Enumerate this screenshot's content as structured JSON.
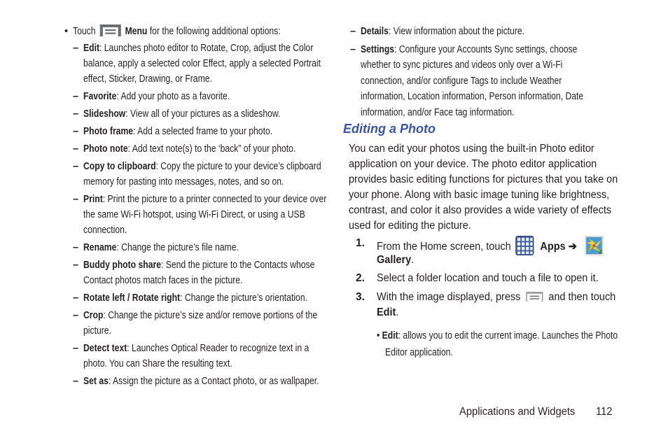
{
  "left_column": {
    "intro": {
      "bullet": "•",
      "prefix": "Touch",
      "icon": "menu-key-icon",
      "menu_label": "Menu",
      "suffix": " for the following additional options:"
    },
    "options": [
      {
        "term": "Edit",
        "lines": [
          ": Launches photo editor to Rotate, Crop, adjust the Color",
          "balance, apply a selected color Effect, apply a selected Portrait",
          "effect, Sticker, Drawing, or Frame."
        ]
      },
      {
        "term": "Favorite",
        "lines": [
          ": Add your photo as a favorite."
        ]
      },
      {
        "term": "Slideshow",
        "lines": [
          ": View all of your pictures as a slideshow."
        ]
      },
      {
        "term": "Photo frame",
        "lines": [
          ": Add a selected frame to your photo."
        ]
      },
      {
        "term": "Photo note",
        "lines": [
          ": Add text note(s) to the ‘back” of your photo."
        ]
      },
      {
        "term": "Copy to clipboard",
        "lines": [
          ": Copy the picture to your device’s clipboard",
          "memory for pasting into messages, notes, and so on."
        ]
      },
      {
        "term": "Print",
        "lines": [
          ": Print the picture to a printer connected to your device over",
          "the same Wi-Fi hotspot, using Wi-Fi Direct, or using a USB",
          "connection."
        ]
      },
      {
        "term": "Rename",
        "lines": [
          ": Change the picture’s file name."
        ]
      },
      {
        "term": "Buddy photo share",
        "lines": [
          ": Send the picture to the Contacts whose",
          "Contact photos match faces in the picture."
        ]
      },
      {
        "term": "Rotate left",
        "term2_sep": " / ",
        "term2": "Rotate right",
        "lines": [
          ": Change the picture’s orientation."
        ]
      },
      {
        "term": "Crop",
        "lines": [
          ": Change the picture’s size and/or remove portions of the",
          "picture."
        ]
      },
      {
        "term": "Detect text",
        "lines": [
          ": Launches Optical Reader to recognize text in a",
          "photo. You can Share the resulting text."
        ]
      },
      {
        "term": "Set as",
        "lines": [
          ": Assign the picture as a Contact photo, or as wallpaper."
        ]
      }
    ]
  },
  "right_column": {
    "options": [
      {
        "term": "Details",
        "lines": [
          ": View information about the picture."
        ]
      },
      {
        "term": "Settings",
        "lines": [
          ": Configure your Accounts Sync settings, choose",
          "whether to sync pictures and videos only over a Wi-Fi",
          "connection, and/or configure Tags to include Weather",
          "information, Location information, Person information, Date",
          "information, and/or Face tag information."
        ]
      }
    ],
    "dash": "–",
    "section": {
      "heading": "Editing a Photo",
      "heading_color": "#3a55a4",
      "paragraph_lines": [
        "You can edit your photos using the built-in Photo editor",
        "application on your device. The photo editor application",
        "provides basic editing functions for pictures that you take on",
        "your phone. Along with basic image tuning like brightness,",
        "contrast, and color it also provides a wide variety of effects",
        "used for editing the picture."
      ],
      "steps": [
        {
          "num": "1.",
          "text_a": "From the Home screen, touch",
          "icon_a": "apps-icon",
          "bold_a": "Apps",
          "arrow": "➔",
          "icon_b": "gallery-icon",
          "bold_b": "Gallery",
          "end": "."
        },
        {
          "num": "2.",
          "text": "Select a folder location and touch a file to open it."
        },
        {
          "num": "3.",
          "text_a": "With the image displayed, press",
          "icon_a": "menu-key-icon",
          "text_b": "and then touch",
          "bold_b": "Edit",
          "end": "."
        }
      ],
      "sub_bullet": {
        "bullet": "•",
        "term": "Edit",
        "lines": [
          ": allows you to edit the current image. Launches the Photo",
          "Editor application."
        ]
      }
    }
  },
  "footer": {
    "section_title": "Applications and Widgets",
    "page_number": "112"
  }
}
